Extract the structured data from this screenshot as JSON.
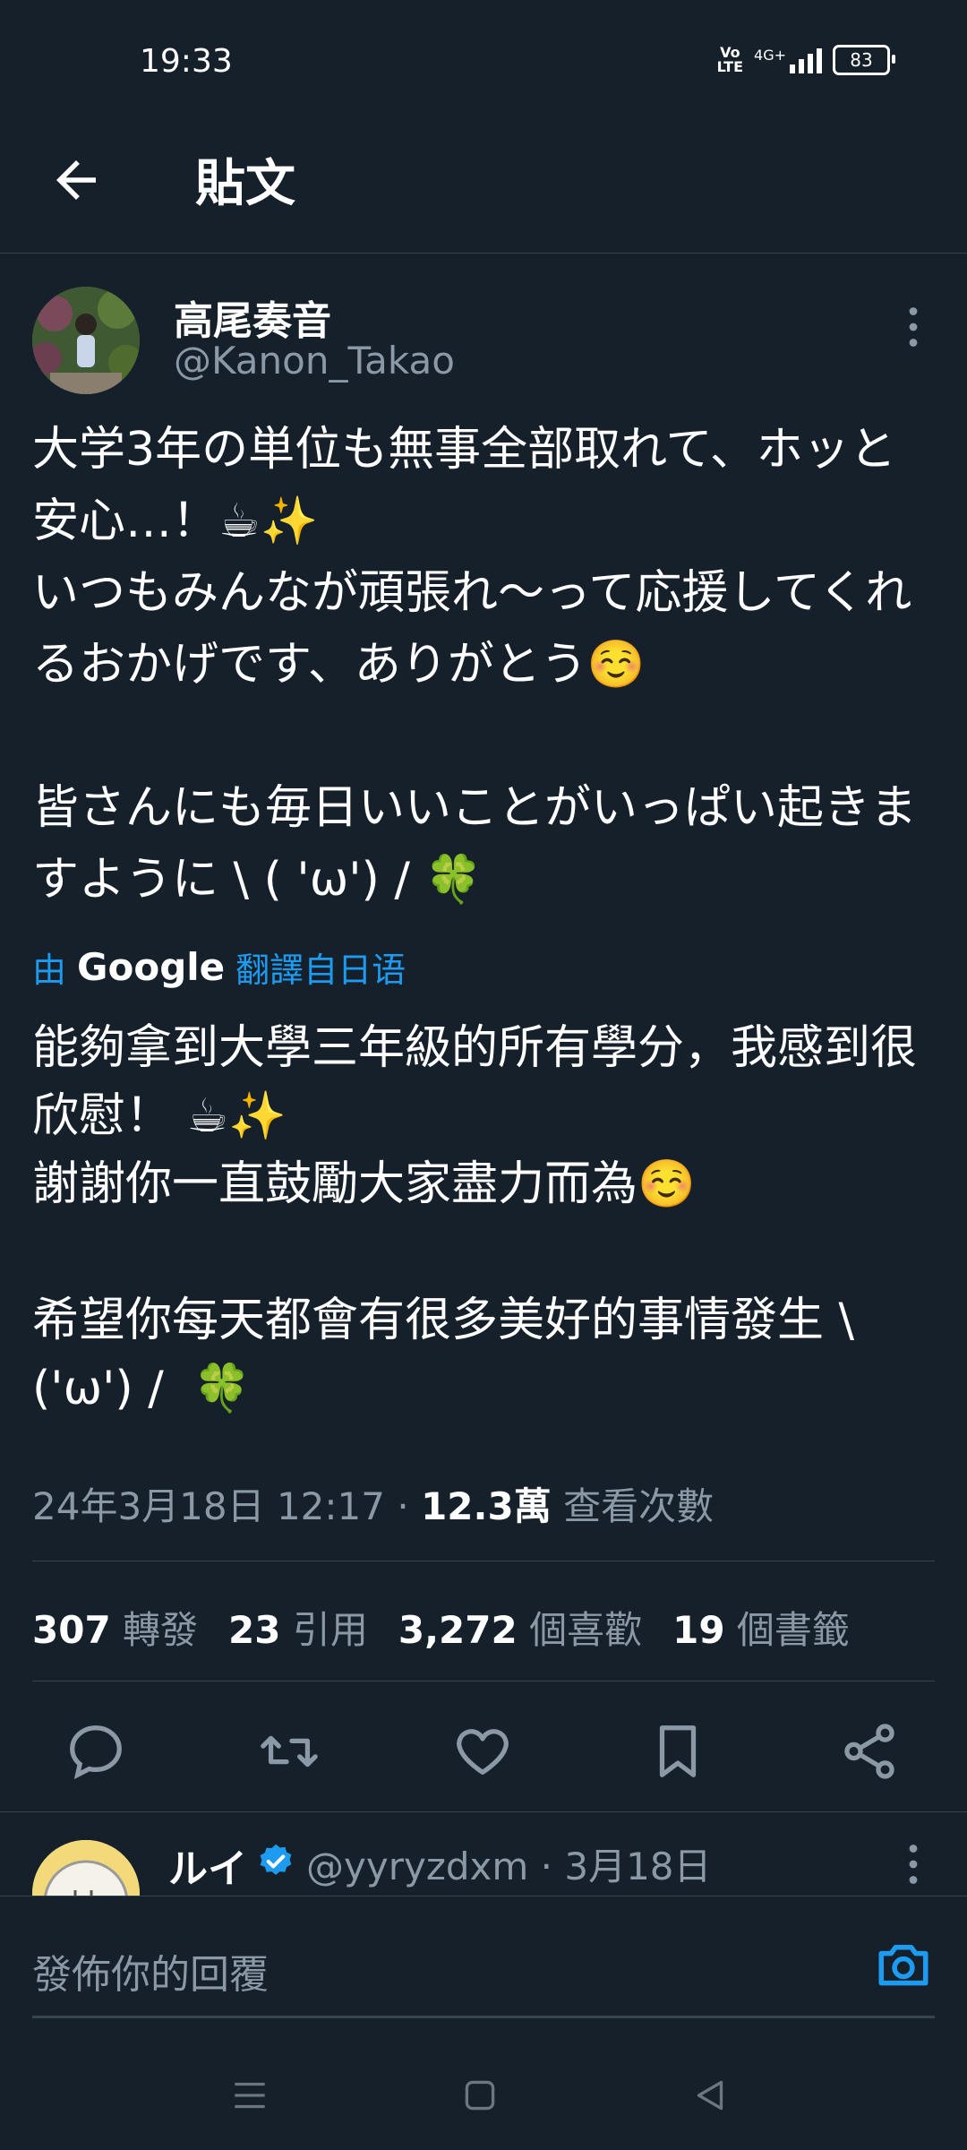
{
  "status_bar": {
    "time": "19:33",
    "volte_line1": "Vo",
    "volte_line2": "LTE",
    "network": "4G+",
    "battery": "83"
  },
  "header": {
    "title": "貼文"
  },
  "tweet": {
    "author_name": "高尾奏音",
    "author_handle": "@Kanon_Takao",
    "text": "大学3年の単位も無事全部取れて、ホッと安心…！☕✨\nいつもみんなが頑張れ〜って応援してくれるおかげです、ありがとう☺️\n\n皆さんにも毎日いいことがいっぱい起きますように \\ ( 'ω') / 🍀",
    "translate_prefix": "由",
    "translate_brand": "Google",
    "translate_suffix": "翻譯自日语",
    "translated_text": "能夠拿到大學三年級的所有學分，我感到很欣慰！ ☕✨\n謝謝你一直鼓勵大家盡力而為☺️\n\n希望你每天都會有很多美好的事情發生 \\ ('ω') /  🍀",
    "timestamp": "24年3月18日 12:17",
    "separator": "·",
    "views_count": "12.3萬",
    "views_label": "查看次數"
  },
  "stats": {
    "retweets_count": "307",
    "retweets_label": "轉發",
    "quotes_count": "23",
    "quotes_label": "引用",
    "likes_count": "3,272",
    "likes_label": "個喜歡",
    "bookmarks_count": "19",
    "bookmarks_label": "個書籤"
  },
  "actions": [
    "reply-icon",
    "retweet-icon",
    "like-icon",
    "bookmark-icon",
    "share-icon"
  ],
  "reply": {
    "name": "ルイ",
    "handle": "@yyryzdxm · 3月18日"
  },
  "compose": {
    "placeholder": "發佈你的回覆"
  },
  "colors": {
    "background": "#15202b",
    "accent": "#1d9bf0",
    "muted": "#8b98a5",
    "divider": "#38444d"
  }
}
